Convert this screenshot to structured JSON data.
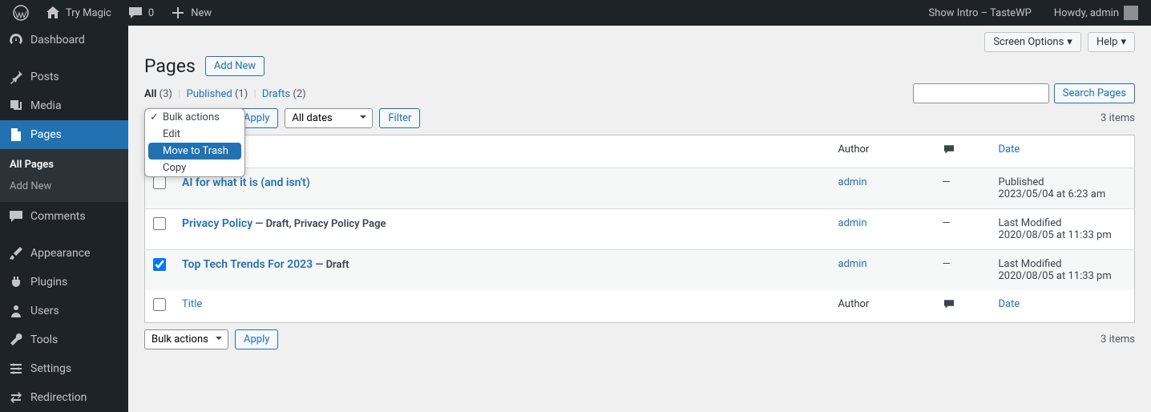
{
  "adminbar": {
    "try_magic": "Try Magic",
    "comments_count": "0",
    "new": "New",
    "show_intro": "Show Intro – TasteWP",
    "howdy": "Howdy, admin"
  },
  "sidebar": {
    "items": [
      {
        "label": "Dashboard"
      },
      {
        "label": "Posts"
      },
      {
        "label": "Media"
      },
      {
        "label": "Pages"
      },
      {
        "label": "Comments"
      },
      {
        "label": "Appearance"
      },
      {
        "label": "Plugins"
      },
      {
        "label": "Users"
      },
      {
        "label": "Tools"
      },
      {
        "label": "Settings"
      },
      {
        "label": "Redirection"
      }
    ],
    "submenu": {
      "all_pages": "All Pages",
      "add_new": "Add New"
    }
  },
  "header": {
    "screen_options": "Screen Options",
    "help": "Help",
    "title": "Pages",
    "add_new": "Add New"
  },
  "filters": {
    "all": "All",
    "all_count": "(3)",
    "published": "Published",
    "published_count": "(1)",
    "drafts": "Drafts",
    "drafts_count": "(2)"
  },
  "bulk": {
    "label": "Bulk actions",
    "options": [
      "Bulk actions",
      "Edit",
      "Move to Trash",
      "Copy"
    ],
    "apply": "Apply",
    "all_dates": "All dates",
    "filter": "Filter"
  },
  "search": {
    "button": "Search Pages"
  },
  "items_count": "3 items",
  "table": {
    "headers": {
      "title": "Title",
      "author": "Author",
      "date": "Date"
    },
    "rows": [
      {
        "title": "AI for what it is (and isn't)",
        "state": "",
        "author": "admin",
        "comments": "—",
        "date_status": "Published",
        "date": "2023/05/04 at 6:23 am",
        "checked": false
      },
      {
        "title": "Privacy Policy",
        "state": " — Draft, Privacy Policy Page",
        "author": "admin",
        "comments": "—",
        "date_status": "Last Modified",
        "date": "2020/08/05 at 11:33 pm",
        "checked": false
      },
      {
        "title": "Top Tech Trends For 2023",
        "state": " — Draft",
        "author": "admin",
        "comments": "—",
        "date_status": "Last Modified",
        "date": "2020/08/05 at 11:33 pm",
        "checked": true
      }
    ]
  }
}
